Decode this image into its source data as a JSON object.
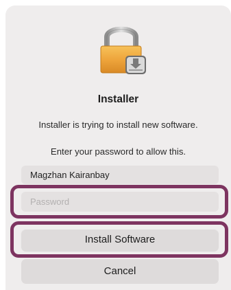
{
  "dialog": {
    "title": "Installer",
    "message": "Installer is trying to install new software.",
    "prompt": "Enter your password to allow this.",
    "icon": "padlock-icon",
    "badge_icon": "install-arrow-icon"
  },
  "form": {
    "username_value": "Magzhan Kairanbay",
    "password_placeholder": "Password"
  },
  "buttons": {
    "install_label": "Install Software",
    "cancel_label": "Cancel"
  },
  "colors": {
    "highlight": "#7d3460",
    "dialog_background": "#efeded"
  }
}
